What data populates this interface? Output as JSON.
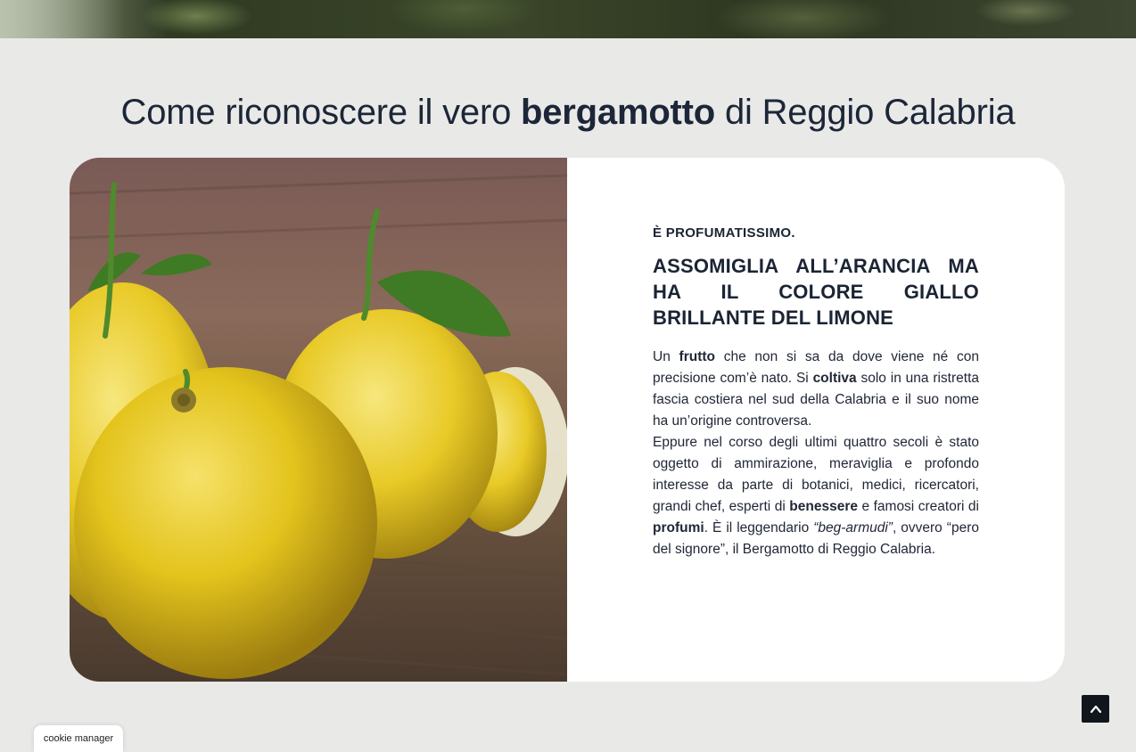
{
  "title": {
    "part1": "Come riconoscere il vero ",
    "bold": "bergamotto",
    "part2": " di Reggio Calabria"
  },
  "card": {
    "image_alt": "bergamotti",
    "kicker": "È PROFUMATISSIMO.",
    "headline": "ASSOMIGLIA ALL’ARANCIA MA HA IL COLORE GIALLO BRILLANTE DEL LIMONE",
    "p1": {
      "t1": "Un ",
      "b1": "frutto",
      "t2": " che non si sa da dove viene né con precisione com’è nato. Si ",
      "b2": "coltiva",
      "t3": " solo in una ristretta fascia costiera nel sud della Calabria e il suo nome ha un’origine controversa."
    },
    "p2": {
      "t1": "Eppure nel corso degli ultimi quattro secoli è stato oggetto di ammirazione, meraviglia e profondo interesse da parte di botanici, medici, ricercatori, grandi chef, esperti di ",
      "b1": "benessere",
      "t2": " e famosi creatori di ",
      "b2": "profumi",
      "t3": ". È il leggendario ",
      "i1": "“beg-armudi”",
      "t4": ", ovvero “pero del signore”, il Bergamotto di Reggio Calabria."
    }
  },
  "cookie_manager_label": "cookie manager",
  "icons": {
    "scroll_top": "chevron-up-icon"
  },
  "colors": {
    "page_bg": "#e9e9e7",
    "card_bg": "#ffffff",
    "text": "#1c2638",
    "scroll_btn": "#11151c"
  }
}
